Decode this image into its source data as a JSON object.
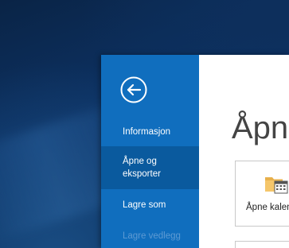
{
  "backstage": {
    "back_icon": "arrow-left-circle-icon",
    "nav_items": [
      {
        "label": "Informasjon",
        "state": "normal"
      },
      {
        "label": "Åpne og\neksporter",
        "state": "selected"
      },
      {
        "label": "Lagre som",
        "state": "normal"
      },
      {
        "label": "Lagre vedlegg",
        "state": "disabled"
      }
    ]
  },
  "content": {
    "title": "Åpne og eksporter",
    "tiles": [
      {
        "label": "Åpne kalender",
        "icon": "calendar-folder-icon"
      },
      {
        "label": "",
        "icon": ""
      }
    ]
  },
  "colors": {
    "nav_bg": "#106ebe",
    "nav_selected": "#0a5a9e",
    "nav_disabled_text": "#5d9ad3",
    "content_bg": "#ffffff"
  }
}
